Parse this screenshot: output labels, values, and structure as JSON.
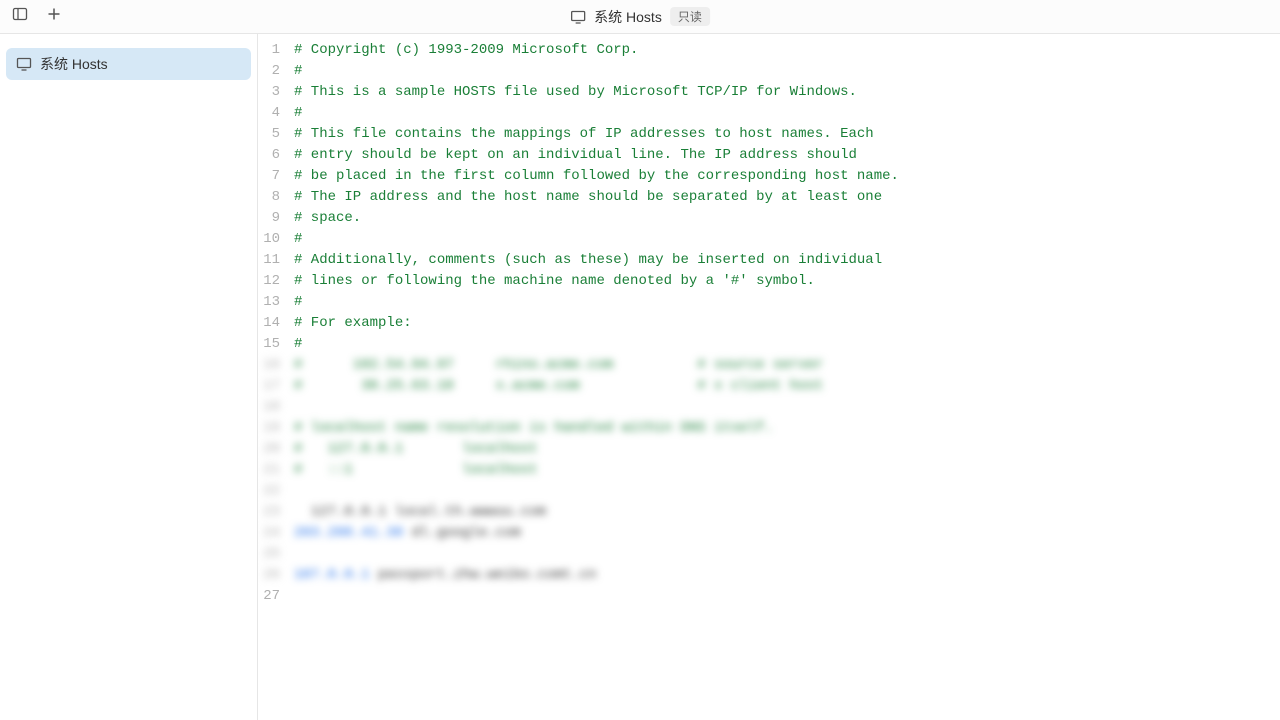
{
  "toolbar": {
    "title": "系统 Hosts",
    "readonly_badge": "只读"
  },
  "sidebar": {
    "items": [
      {
        "label": "系统 Hosts",
        "active": true
      }
    ]
  },
  "editor": {
    "lines": [
      {
        "n": 1,
        "blur": false,
        "tokens": [
          {
            "cls": "tok-comment",
            "t": "# Copyright (c) 1993-2009 Microsoft Corp."
          }
        ]
      },
      {
        "n": 2,
        "blur": false,
        "tokens": [
          {
            "cls": "tok-comment",
            "t": "#"
          }
        ]
      },
      {
        "n": 3,
        "blur": false,
        "tokens": [
          {
            "cls": "tok-comment",
            "t": "# This is a sample HOSTS file used by Microsoft TCP/IP for Windows."
          }
        ]
      },
      {
        "n": 4,
        "blur": false,
        "tokens": [
          {
            "cls": "tok-comment",
            "t": "#"
          }
        ]
      },
      {
        "n": 5,
        "blur": false,
        "tokens": [
          {
            "cls": "tok-comment",
            "t": "# This file contains the mappings of IP addresses to host names. Each"
          }
        ]
      },
      {
        "n": 6,
        "blur": false,
        "tokens": [
          {
            "cls": "tok-comment",
            "t": "# entry should be kept on an individual line. The IP address should"
          }
        ]
      },
      {
        "n": 7,
        "blur": false,
        "tokens": [
          {
            "cls": "tok-comment",
            "t": "# be placed in the first column followed by the corresponding host name."
          }
        ]
      },
      {
        "n": 8,
        "blur": false,
        "tokens": [
          {
            "cls": "tok-comment",
            "t": "# The IP address and the host name should be separated by at least one"
          }
        ]
      },
      {
        "n": 9,
        "blur": false,
        "tokens": [
          {
            "cls": "tok-comment",
            "t": "# space."
          }
        ]
      },
      {
        "n": 10,
        "blur": false,
        "tokens": [
          {
            "cls": "tok-comment",
            "t": "#"
          }
        ]
      },
      {
        "n": 11,
        "blur": false,
        "tokens": [
          {
            "cls": "tok-comment",
            "t": "# Additionally, comments (such as these) may be inserted on individual"
          }
        ]
      },
      {
        "n": 12,
        "blur": false,
        "tokens": [
          {
            "cls": "tok-comment",
            "t": "# lines or following the machine name denoted by a '#' symbol."
          }
        ]
      },
      {
        "n": 13,
        "blur": false,
        "tokens": [
          {
            "cls": "tok-comment",
            "t": "#"
          }
        ]
      },
      {
        "n": 14,
        "blur": false,
        "tokens": [
          {
            "cls": "tok-comment",
            "t": "# For example:"
          }
        ]
      },
      {
        "n": 15,
        "blur": false,
        "tokens": [
          {
            "cls": "tok-comment",
            "t": "#"
          }
        ]
      },
      {
        "n": 16,
        "blur": true,
        "tokens": [
          {
            "cls": "tok-comment",
            "t": "#      102.54.94.97     rhino.acme.com          # source server"
          }
        ]
      },
      {
        "n": 17,
        "blur": true,
        "tokens": [
          {
            "cls": "tok-comment",
            "t": "#       38.25.63.10     x.acme.com              # x client host"
          }
        ]
      },
      {
        "n": 18,
        "blur": true,
        "tokens": [
          {
            "cls": "tok-plain",
            "t": ""
          }
        ]
      },
      {
        "n": 19,
        "blur": true,
        "tokens": [
          {
            "cls": "tok-comment",
            "t": "# localhost name resolution is handled within DNS itself."
          }
        ]
      },
      {
        "n": 20,
        "blur": true,
        "tokens": [
          {
            "cls": "tok-comment",
            "t": "#   127.0.0.1       localhost"
          }
        ]
      },
      {
        "n": 21,
        "blur": true,
        "tokens": [
          {
            "cls": "tok-comment",
            "t": "#   ::1             localhost"
          }
        ]
      },
      {
        "n": 22,
        "blur": true,
        "tokens": [
          {
            "cls": "tok-plain",
            "t": ""
          }
        ]
      },
      {
        "n": 23,
        "blur": true,
        "tokens": [
          {
            "cls": "tok-plain",
            "t": "  127.0.0.1 local.th.wwwuu.com"
          }
        ]
      },
      {
        "n": 24,
        "blur": true,
        "tokens": [
          {
            "cls": "tok-ip",
            "t": "203.208.41.38"
          },
          {
            "cls": "tok-plain",
            "t": " dl.google.com"
          }
        ]
      },
      {
        "n": 25,
        "blur": true,
        "tokens": [
          {
            "cls": "tok-plain",
            "t": ""
          }
        ]
      },
      {
        "n": 26,
        "blur": true,
        "tokens": [
          {
            "cls": "tok-ip",
            "t": "107.0.0.1"
          },
          {
            "cls": "tok-plain",
            "t": " passport.zhw.weibo.comt.cn"
          }
        ]
      },
      {
        "n": 27,
        "blur": false,
        "tokens": [
          {
            "cls": "tok-plain",
            "t": ""
          }
        ]
      }
    ]
  }
}
